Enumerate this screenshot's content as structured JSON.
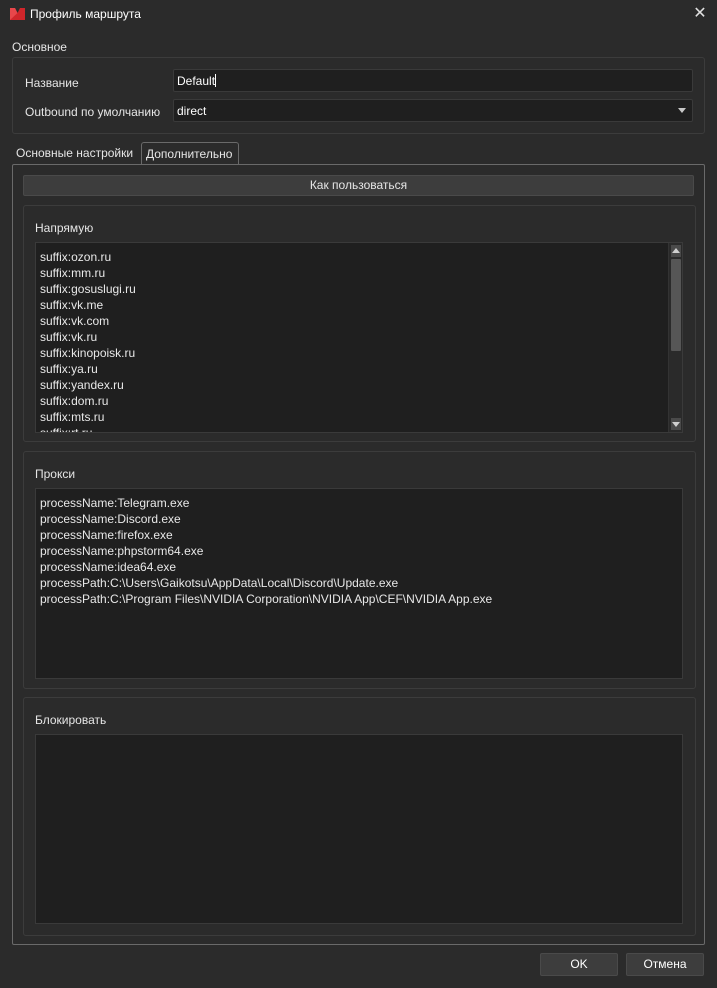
{
  "window": {
    "title": "Профиль маршрута",
    "close_glyph": "✕",
    "icon": "app-logo-icon",
    "accent_color": "#d0262b"
  },
  "basic_section": {
    "label": "Основное",
    "name_label": "Название",
    "name_value": "Default",
    "outbound_label": "Outbound по умолчанию",
    "outbound_value": "direct"
  },
  "tabs": [
    {
      "label": "Основные настройки",
      "selected": false
    },
    {
      "label": "Дополнительно",
      "selected": true
    }
  ],
  "help_button_label": "Как пользоваться",
  "direct": {
    "title": "Напрямую",
    "lines": [
      "suffix:ozon.ru",
      "suffix:mm.ru",
      "suffix:gosuslugi.ru",
      "suffix:vk.me",
      "suffix:vk.com",
      "suffix:vk.ru",
      "suffix:kinopoisk.ru",
      "suffix:ya.ru",
      "suffix:yandex.ru",
      "suffix:dom.ru",
      "suffix:mts.ru",
      "suffix:rt.ru"
    ]
  },
  "proxy": {
    "title": "Прокси",
    "lines": [
      "processName:Telegram.exe",
      "processName:Discord.exe",
      "processName:firefox.exe",
      "processName:phpstorm64.exe",
      "processName:idea64.exe",
      "processPath:C:\\Users\\Gaikotsu\\AppData\\Local\\Discord\\Update.exe",
      "processPath:C:\\Program Files\\NVIDIA Corporation\\NVIDIA App\\CEF\\NVIDIA App.exe"
    ]
  },
  "block": {
    "title": "Блокировать",
    "lines": []
  },
  "buttons": {
    "ok": "OK",
    "cancel": "Отмена"
  }
}
